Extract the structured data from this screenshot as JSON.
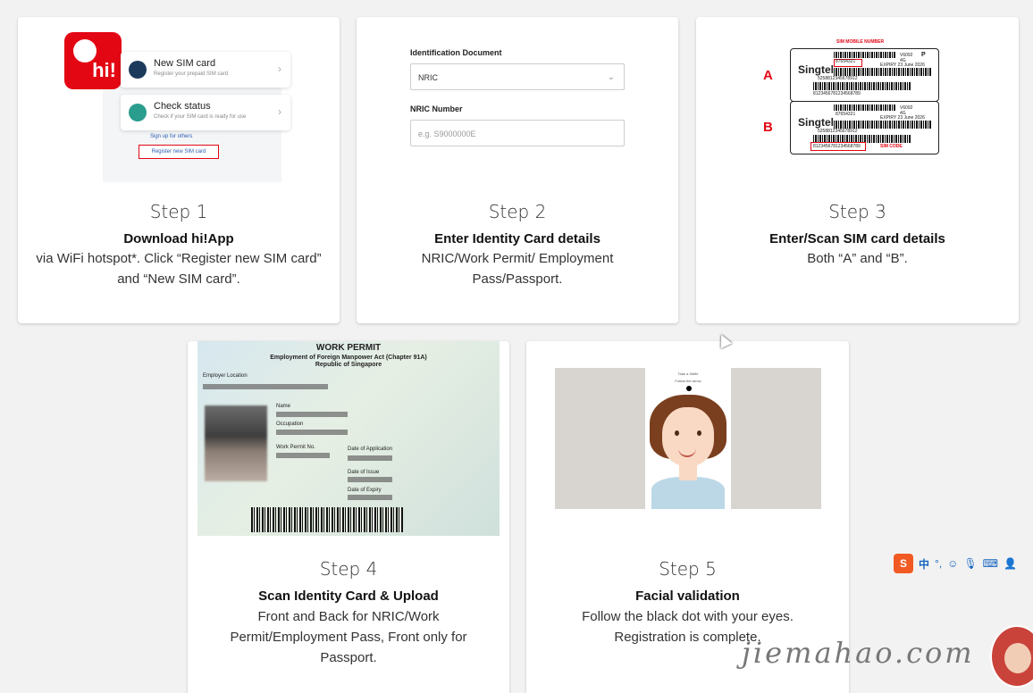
{
  "steps": [
    {
      "num": "Step 1",
      "title": "Download hi!App",
      "desc": "via WiFi hotspot*. Click “Register new SIM card” and “New SIM card”."
    },
    {
      "num": "Step 2",
      "title": "Enter Identity Card details",
      "desc": "NRIC/Work Permit/ Employment Pass/Passport."
    },
    {
      "num": "Step 3",
      "title": "Enter/Scan SIM card details",
      "desc": "Both “A” and “B”."
    },
    {
      "num": "Step 4",
      "title": "Scan Identity Card & Upload",
      "desc": "Front and Back for NRIC/Work Permit/Employment Pass, Front only for Passport."
    },
    {
      "num": "Step 5",
      "title": "Facial validation",
      "desc": "Follow the black dot with your eyes. Registration is complete."
    }
  ],
  "app_mock": {
    "logo": "hi!",
    "new_sim_title": "New SIM card",
    "new_sim_sub": "Register your prepaid SIM card",
    "check_title": "Check status",
    "check_sub": "Check if your SIM card is ready for use",
    "signup_link": "Sign up for others",
    "register_button": "Register new SIM card"
  },
  "id_form": {
    "doc_label": "Identification Document",
    "doc_value": "NRIC",
    "nric_label": "NRIC Number",
    "nric_placeholder": "e.g. S9000000E"
  },
  "sim_card": {
    "label_a": "A",
    "label_b": "B",
    "brand": "Singtel",
    "mobile_number_label": "SIM MOBILE NUMBER",
    "mobile_number": "87654321",
    "sim_code_label": "SIM CODE",
    "sim_code": "8123456781234568789",
    "card_code": "5258812345678912",
    "model": "V6092",
    "type": "P",
    "net": "4G",
    "expiry": "EXPIRY 23 June 2026"
  },
  "permit": {
    "title": "WORK PERMIT",
    "subtitle_1": "Employment of Foreign Manpower Act (Chapter 91A)",
    "subtitle_2": "Republic of Singapore",
    "employer": "Employer Location",
    "name": "Name",
    "occupation": "Occupation",
    "permit_no": "Work Permit No.",
    "date_app": "Date of Application",
    "date_issue": "Date of Issue",
    "date_expiry": "Date of Expiry"
  },
  "selfie": {
    "header": "Take a Selfie",
    "sub": "Follow the arrow"
  },
  "ime": {
    "lang": "中"
  },
  "watermark": "jiemahao.com",
  "colors": {
    "accent": "#e30613",
    "link": "#2a5db0",
    "background": "#f2f2f2"
  }
}
